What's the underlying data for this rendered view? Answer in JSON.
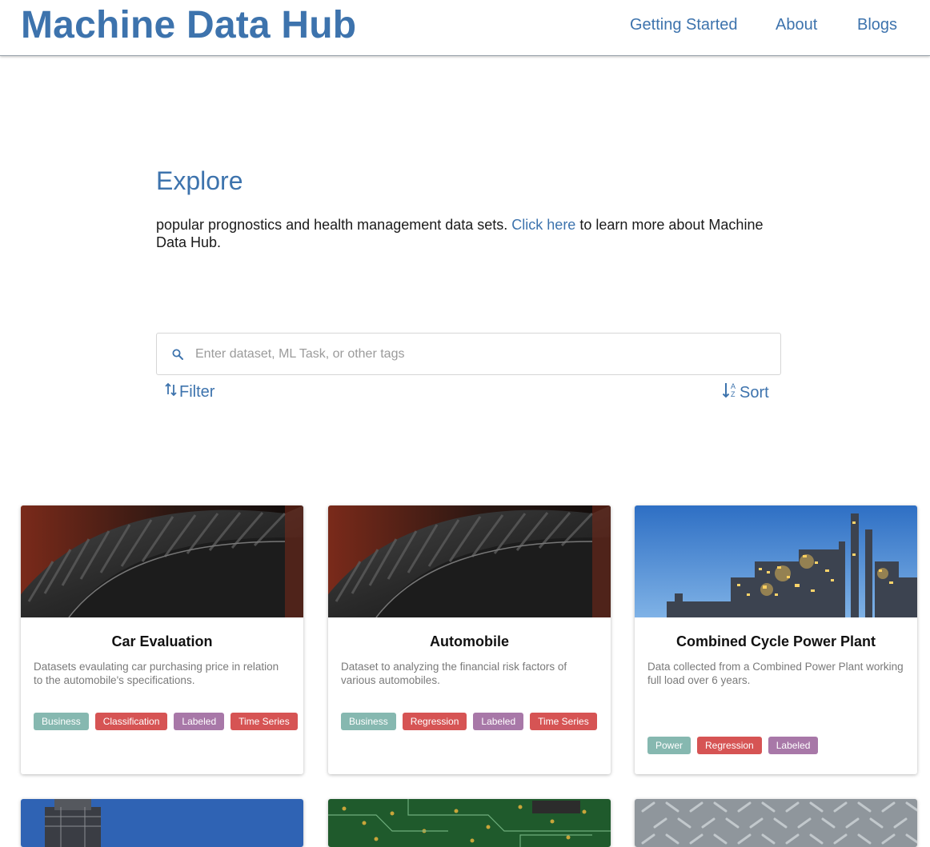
{
  "header": {
    "brand": "Machine Data Hub",
    "nav": [
      {
        "label": "Getting Started"
      },
      {
        "label": "About"
      },
      {
        "label": "Blogs"
      }
    ]
  },
  "hero": {
    "title": "Explore",
    "text_before": "popular prognostics and health management data sets. ",
    "link_text": "Click here",
    "text_after": " to learn more about Machine Data Hub."
  },
  "search": {
    "placeholder": "Enter dataset, ML Task, or other tags",
    "value": ""
  },
  "controls": {
    "filter_label": "Filter",
    "sort_label": "Sort"
  },
  "colors": {
    "brand": "#3d73ad",
    "tag_domain": "#86b8b0",
    "tag_task": "#d65454",
    "tag_labeled": "#a878a8"
  },
  "cards": [
    {
      "title": "Car Evaluation",
      "description": "Datasets evaulating car purchasing price in relation to the automobile's specifications.",
      "image": "tire-image",
      "tags": [
        "Business",
        "Classification",
        "Labeled",
        "Time Series"
      ]
    },
    {
      "title": "Automobile",
      "description": "Dataset to analyzing the financial risk factors of various automobiles.",
      "image": "tire-image",
      "tags": [
        "Business",
        "Regression",
        "Labeled",
        "Time Series"
      ]
    },
    {
      "title": "Combined Cycle Power Plant",
      "description": "Data collected from a Combined Power Plant working full load over 6 years.",
      "image": "power-plant-image",
      "tags": [
        "Power",
        "Regression",
        "Labeled"
      ]
    }
  ],
  "partial_cards": [
    {
      "image": "tower-image"
    },
    {
      "image": "circuit-board-image"
    },
    {
      "image": "diamond-plate-image"
    }
  ]
}
